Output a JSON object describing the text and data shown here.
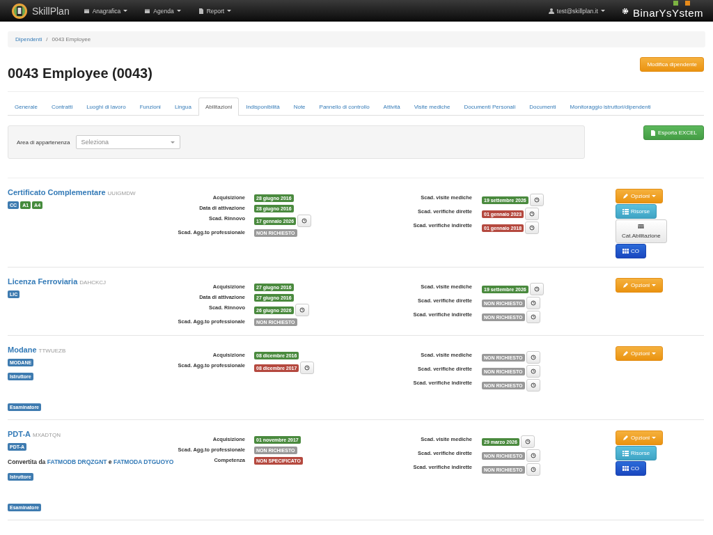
{
  "navbar": {
    "brand": "SkillPlan",
    "menus": [
      {
        "label": "Anagrafica"
      },
      {
        "label": "Agenda"
      },
      {
        "label": "Report"
      }
    ],
    "user": "test@skillplan.it",
    "company_logo": "BinarYsYstem"
  },
  "breadcrumb": [
    {
      "label": "Dipendenti",
      "link": true
    },
    {
      "label": "0043 Employee",
      "link": false
    }
  ],
  "breadcrumb_separator": "/",
  "title": "0043 Employee (0043)",
  "edit_button": "Modifica dipendente",
  "tabs": [
    {
      "label": "Generale",
      "selected": false
    },
    {
      "label": "Contratti",
      "selected": false
    },
    {
      "label": "Luoghi di lavoro",
      "selected": false
    },
    {
      "label": "Funzioni",
      "selected": false
    },
    {
      "label": "Lingua",
      "selected": false
    },
    {
      "label": "Abilitazioni",
      "selected": true
    },
    {
      "label": "Indisponibilità",
      "selected": false
    },
    {
      "label": "Note",
      "selected": false
    },
    {
      "label": "Pannello di controllo",
      "selected": false
    },
    {
      "label": "Attività",
      "selected": false
    },
    {
      "label": "Visite mediche",
      "selected": false
    },
    {
      "label": "Documenti Personali",
      "selected": false
    },
    {
      "label": "Documenti",
      "selected": false
    },
    {
      "label": "Monitoraggio istruttori/dipendenti",
      "selected": false
    }
  ],
  "filter": {
    "label": "Area di appartenenza",
    "placeholder": "Seleziona"
  },
  "export_button": "Esporta EXCEL",
  "qualifications": [
    {
      "name": "Certificato Complementare",
      "code": "UUIGMDW",
      "tags": [
        {
          "label": "CC",
          "color": "#3e7bb0"
        },
        {
          "label": "A1",
          "color": "#458b3c"
        },
        {
          "label": "A4",
          "color": "#458b3c"
        }
      ],
      "dates": [
        {
          "label": "Acquisizione",
          "value": "28 giugno 2016",
          "color": "#4a8a3e",
          "action": false
        },
        {
          "label": "Data di attivazione",
          "value": "28 giugno 2016",
          "color": "#4a8a3e",
          "action": false
        },
        {
          "label": "Scad. Rinnovo",
          "value": "17 gennaio 2026",
          "color": "#4a8a3e",
          "action": true
        },
        {
          "label": "Scad. Agg.to professionale",
          "value": "NON RICHIESTO",
          "color": "#999999",
          "action": false
        }
      ],
      "checks": [
        {
          "label": "Scad. visite mediche",
          "value": "19 settembre 2026",
          "color": "#4a8a3e",
          "action": true
        },
        {
          "label": "Scad. verifiche dirette",
          "value": "01 gennaio 2023",
          "color": "#b5493f",
          "action": true
        },
        {
          "label": "Scad. verifiche indirette",
          "value": "01 gennaio 2018",
          "color": "#b5493f",
          "action": true
        }
      ],
      "buttons": [
        {
          "kind": "options",
          "label": "Opzioni"
        },
        {
          "kind": "resources",
          "label": "Risorse"
        },
        {
          "kind": "category",
          "label": "Cat.Abilitazione"
        },
        {
          "kind": "co",
          "label": "CO"
        }
      ]
    },
    {
      "name": "Licenza Ferroviaria",
      "code": "DAHCKCJ",
      "tags": [
        {
          "label": "LIC",
          "color": "#3e7bb0"
        }
      ],
      "dates": [
        {
          "label": "Acquisizione",
          "value": "27 giugno 2016",
          "color": "#4a8a3e",
          "action": false
        },
        {
          "label": "Data di attivazione",
          "value": "27 giugno 2016",
          "color": "#4a8a3e",
          "action": false
        },
        {
          "label": "Scad. Rinnovo",
          "value": "26 giugno 2026",
          "color": "#4a8a3e",
          "action": true
        },
        {
          "label": "Scad. Agg.to professionale",
          "value": "NON RICHIESTO",
          "color": "#999999",
          "action": false
        }
      ],
      "checks": [
        {
          "label": "Scad. visite mediche",
          "value": "19 settembre 2026",
          "color": "#4a8a3e",
          "action": true
        },
        {
          "label": "Scad. verifiche dirette",
          "value": "NON RICHIESTO",
          "color": "#999999",
          "action": true
        },
        {
          "label": "Scad. verifiche indirette",
          "value": "NON RICHIESTO",
          "color": "#999999",
          "action": true
        }
      ],
      "buttons": [
        {
          "kind": "options",
          "label": "Opzioni"
        }
      ]
    },
    {
      "name": "Modane",
      "code": "TTWUEZB",
      "tags": [
        {
          "label": "MODANE",
          "color": "#3e7bb0"
        }
      ],
      "roles": [
        "Istruttore",
        "Esaminatore"
      ],
      "dates": [
        {
          "label": "Acquisizione",
          "value": "08 dicembre 2016",
          "color": "#4a8a3e",
          "action": false
        },
        {
          "label": "Scad. Agg.to professionale",
          "value": "08 dicembre 2017",
          "color": "#b5493f",
          "action": true
        }
      ],
      "checks": [
        {
          "label": "Scad. visite mediche",
          "value": "NON RICHIESTO",
          "color": "#999999",
          "action": true
        },
        {
          "label": "Scad. verifiche dirette",
          "value": "NON RICHIESTO",
          "color": "#999999",
          "action": true
        },
        {
          "label": "Scad. verifiche indirette",
          "value": "NON RICHIESTO",
          "color": "#999999",
          "action": true
        }
      ],
      "buttons": [
        {
          "kind": "options",
          "label": "Opzioni"
        }
      ]
    },
    {
      "name": "PDT-A",
      "code": "MXADTQN",
      "tags": [
        {
          "label": "PDT-A",
          "color": "#3e7bb0"
        }
      ],
      "converted_from": {
        "prefix": "Convertita da",
        "joiner": "e",
        "sources": [
          "FATMODB DRQZGNT",
          "FATMODA DTGUOYO"
        ]
      },
      "roles": [
        "Istruttore",
        "Esaminatore"
      ],
      "dates": [
        {
          "label": "Acquisizione",
          "value": "01 novembre 2017",
          "color": "#4a8a3e",
          "action": false
        },
        {
          "label": "Scad. Agg.to professionale",
          "value": "NON RICHIESTO",
          "color": "#999999",
          "action": false
        },
        {
          "label": "Competenza",
          "value": "NON SPECIFICATO",
          "color": "#b5493f",
          "action": false
        }
      ],
      "checks": [
        {
          "label": "Scad. visite mediche",
          "value": "29 marzo 2026",
          "color": "#4a8a3e",
          "action": true
        },
        {
          "label": "Scad. verifiche dirette",
          "value": "NON RICHIESTO",
          "color": "#999999",
          "action": true
        },
        {
          "label": "Scad. verifiche indirette",
          "value": "NON RICHIESTO",
          "color": "#999999",
          "action": true
        }
      ],
      "buttons": [
        {
          "kind": "options",
          "label": "Opzioni"
        },
        {
          "kind": "resources",
          "label": "Risorse"
        },
        {
          "kind": "co",
          "label": "CO"
        }
      ]
    }
  ]
}
